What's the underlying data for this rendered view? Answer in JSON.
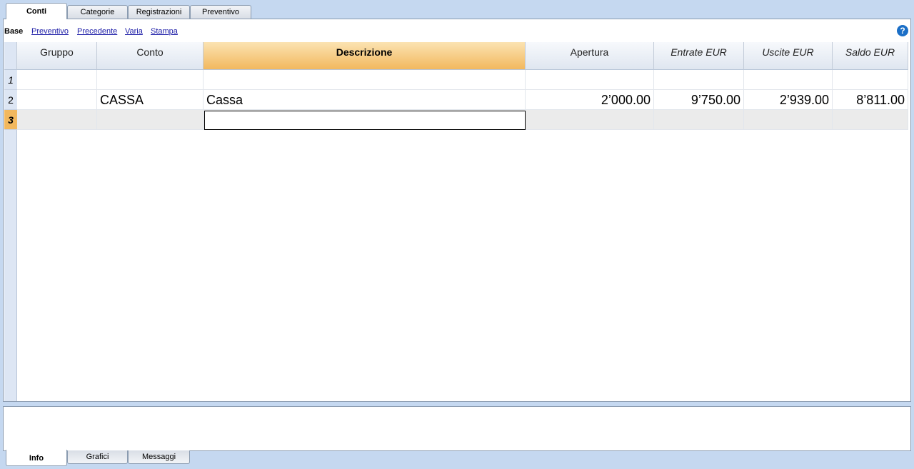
{
  "top_tabs": [
    "Conti",
    "Categorie",
    "Registrazioni",
    "Preventivo"
  ],
  "view_bar": {
    "current": "Base",
    "links": [
      "Preventivo",
      "Precedente",
      "Varia",
      "Stampa"
    ],
    "help_icon": "?"
  },
  "table": {
    "columns": [
      "Gruppo",
      "Conto",
      "Descrizione",
      "Apertura",
      "Entrate EUR",
      "Uscite EUR",
      "Saldo EUR"
    ],
    "rows": [
      {
        "num": "1",
        "gruppo": "",
        "conto": "",
        "descrizione": "",
        "apertura": "",
        "entrate": "",
        "uscite": "",
        "saldo": ""
      },
      {
        "num": "2",
        "gruppo": "",
        "conto": "CASSA",
        "descrizione": "Cassa",
        "apertura": "2’000.00",
        "entrate": "9’750.00",
        "uscite": "2’939.00",
        "saldo": "8’811.00"
      },
      {
        "num": "3",
        "gruppo": "",
        "conto": "",
        "descrizione": "",
        "apertura": "",
        "entrate": "",
        "uscite": "",
        "saldo": ""
      }
    ]
  },
  "bottom_tabs": [
    "Info",
    "Grafici",
    "Messaggi"
  ],
  "colors": {
    "selected_header": "#f2b85e",
    "link": "#1a1aa6",
    "background": "#c5d8f0"
  }
}
